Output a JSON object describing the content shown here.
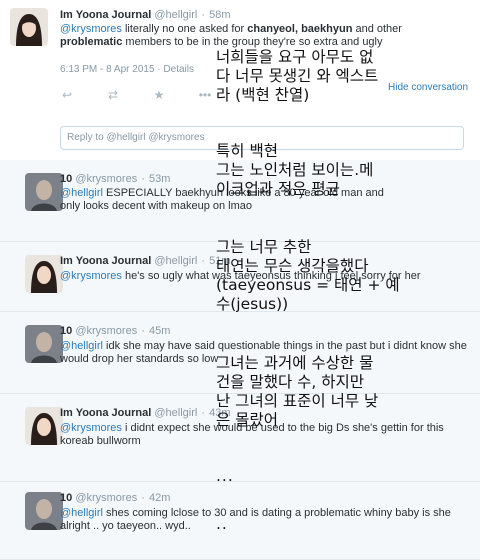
{
  "tweets": [
    {
      "name": "Im Yoona Journal",
      "handle": "@hellgirl",
      "time": "58m",
      "parts": [
        "@krysmores",
        " literally no one asked for ",
        "chanyeol, baekhyun",
        " and other ",
        "problematic",
        " members to be in the group they're so extra and ugly"
      ],
      "meta": {
        "timestamp": "6:13 PM - 8 Apr 2015",
        "details": "Details"
      },
      "hide": "Hide conversation",
      "reply_box": {
        "prefix": "Reply to ",
        "mention1": "@hellgirl",
        "mention2": "@krysmores"
      }
    },
    {
      "name": "10",
      "handle": "@krysmores",
      "time": "53m",
      "parts": [
        "@hellgirl",
        " ESPECIALLY baekhyun looks like a 80 year old man and only looks decent with makeup on lmao"
      ]
    },
    {
      "name": "Im Yoona Journal",
      "handle": "@hellgirl",
      "time": "51m",
      "parts": [
        "@krysmores",
        " he's so ugly what was taeyeonsus thinking i feel sorry for her"
      ]
    },
    {
      "name": "10",
      "handle": "@krysmores",
      "time": "45m",
      "parts": [
        "@hellgirl",
        " idk she may have said questionable things in the past but i didnt know she would drop her standards so low"
      ]
    },
    {
      "name": "Im Yoona Journal",
      "handle": "@hellgirl",
      "time": "43m",
      "parts": [
        "@krysmores",
        " i didnt expect she would be used to the big Ds she's gettin for this koreab bullworm"
      ]
    },
    {
      "name": "10",
      "handle": "@krysmores",
      "time": "42m",
      "parts": [
        "@hellgirl",
        " shes coming lclose to 30 and is dating a problematic whiny baby is she alright .. yo taeyeon.. wyd.."
      ]
    }
  ],
  "overlay": {
    "block1": [
      "너희들을 요구 아무도 없",
      "다 너무 못생긴 와 엑스트",
      "라 (백현 찬열)"
    ],
    "block2": [
      "특히 백현",
      "그는 노인처럼 보이는.메",
      "이크업과 적은 평균"
    ],
    "block3": [
      "그는 너무 추한",
      "태연는 무슨 생각을했다",
      "(taeyeonsus = 태연 + 예",
      "수(jesus))"
    ],
    "block4": [
      "그녀는 과거에 수상한 물",
      "건을 말했다 수, 하지만",
      "난 그녀의 표준이 너무 낮",
      "은 몰랐어"
    ],
    "dots1": "...",
    "dots2": ".."
  },
  "colors": {
    "link": "#2b7bb9",
    "muted": "#8899a6",
    "row_bg": "#f5f8fa"
  },
  "icons": [
    "reply-icon",
    "retweet-icon",
    "favorite-icon",
    "more-icon"
  ]
}
